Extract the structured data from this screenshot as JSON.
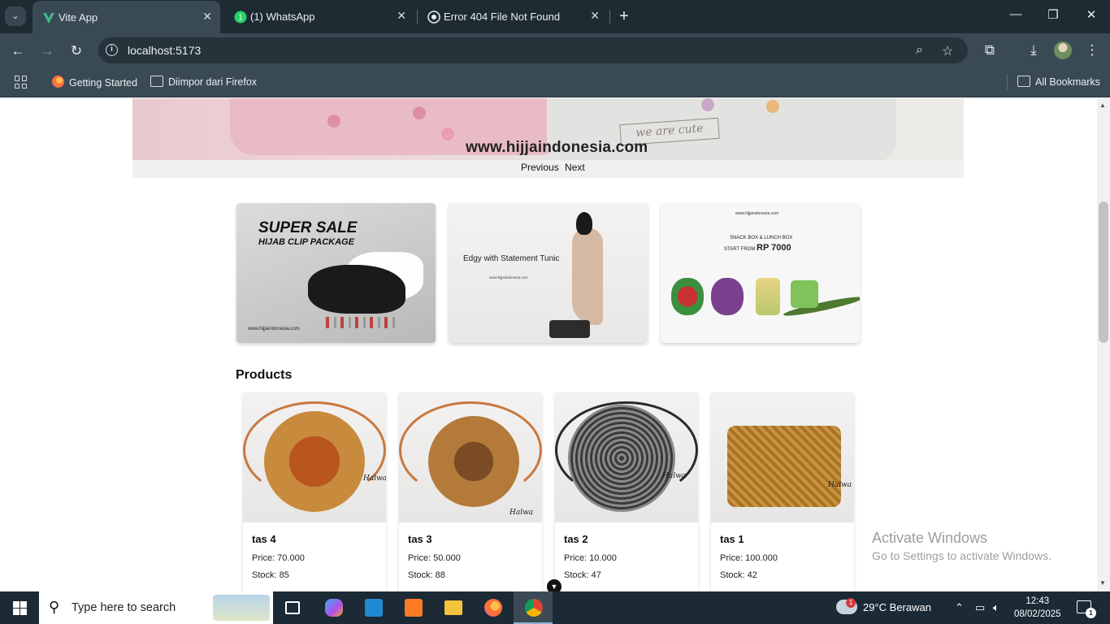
{
  "browser": {
    "tabs": [
      {
        "title": "Vite App",
        "active": true,
        "icon": "vite-icon"
      },
      {
        "title": "(1) WhatsApp",
        "active": false,
        "icon": "whatsapp-icon"
      },
      {
        "title": "Error 404 File Not Found",
        "active": false,
        "icon": "github-icon"
      }
    ],
    "url": "localhost:5173",
    "bookmarks": [
      {
        "label": "Getting Started",
        "icon": "firefox-icon"
      },
      {
        "label": "Diimpor dari Firefox",
        "icon": "folder-icon"
      }
    ],
    "all_bookmarks": "All Bookmarks"
  },
  "hero": {
    "site_text": "www.hijjaindonesia.com",
    "banner_text": "we are cute",
    "prev_label": "Previous",
    "next_label": "Next"
  },
  "promos": [
    {
      "title": "SUPER SALE",
      "subtitle": "HIJAB CLIP PACKAGE",
      "footer": "www.hijjaindonesia.com"
    },
    {
      "title": "Edgy with Statement Tunic",
      "footer": "www.hijjaindonesia.com"
    },
    {
      "site": "www.hijjaindonesia.com",
      "line1": "SNACK BOX & LUNCH BOX",
      "line2_prefix": "START FROM ",
      "line2_value": "RP 7000"
    }
  ],
  "products_title": "Products",
  "products": [
    {
      "name": "tas 4",
      "price": "Price: 70.000",
      "stock": "Stock: 85",
      "brand": "Halwa"
    },
    {
      "name": "tas 3",
      "price": "Price: 50.000",
      "stock": "Stock: 88",
      "brand": "Halwa"
    },
    {
      "name": "tas 2",
      "price": "Price: 10.000",
      "stock": "Stock: 47",
      "brand": "Halwa"
    },
    {
      "name": "tas 1",
      "price": "Price: 100.000",
      "stock": "Stock: 42",
      "brand": "Halwa"
    }
  ],
  "watermark": {
    "line1": "Activate Windows",
    "line2": "Go to Settings to activate Windows."
  },
  "taskbar": {
    "search_placeholder": "Type here to search",
    "weather": "29°C  Berawan",
    "weather_badge": "1",
    "time": "12:43",
    "date": "08/02/2025",
    "notification_count": "1"
  }
}
